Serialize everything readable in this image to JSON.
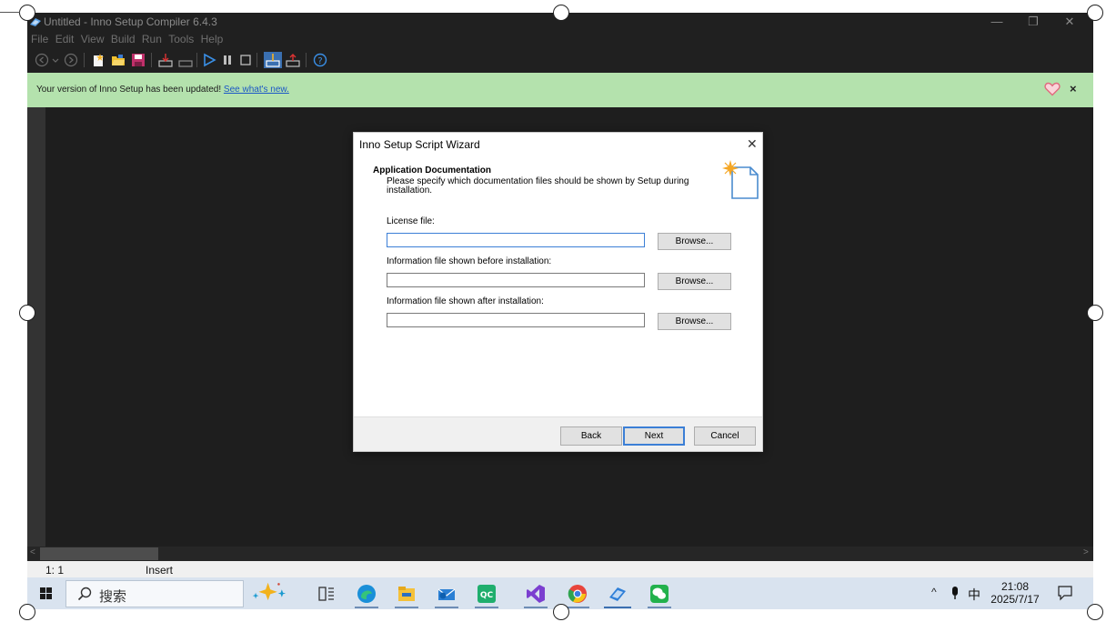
{
  "window": {
    "title": "Untitled - Inno Setup Compiler 6.4.3",
    "controls": {
      "minimize": "—",
      "maximize": "❐",
      "close": "✕"
    }
  },
  "menu": [
    "File",
    "Edit",
    "View",
    "Build",
    "Run",
    "Tools",
    "Help"
  ],
  "notice": {
    "message": "Your version of Inno Setup has been updated!",
    "link": "See what's new.",
    "close": "×"
  },
  "dialog": {
    "title": "Inno Setup Script Wizard",
    "close": "✕",
    "heading": "Application Documentation",
    "description": "Please specify which documentation files should be shown by Setup during installation.",
    "fields": [
      {
        "label": "License file:",
        "value": "",
        "button": "Browse..."
      },
      {
        "label": "Information file shown before installation:",
        "value": "",
        "button": "Browse..."
      },
      {
        "label": "Information file shown after installation:",
        "value": "",
        "button": "Browse..."
      }
    ],
    "buttons": {
      "back": "Back",
      "next": "Next",
      "cancel": "Cancel"
    }
  },
  "status": {
    "position": "1:  1",
    "mode": "Insert"
  },
  "taskbar": {
    "search_text": "搜索",
    "time": "21:08",
    "date": "2025/7/17",
    "ime": "中",
    "tray_chevron": "^"
  },
  "colors": {
    "notice_bg": "#b4e2ad",
    "editor_bg": "#1e1e1e",
    "link": "#1b57c6",
    "accent": "#3c7fd6"
  }
}
